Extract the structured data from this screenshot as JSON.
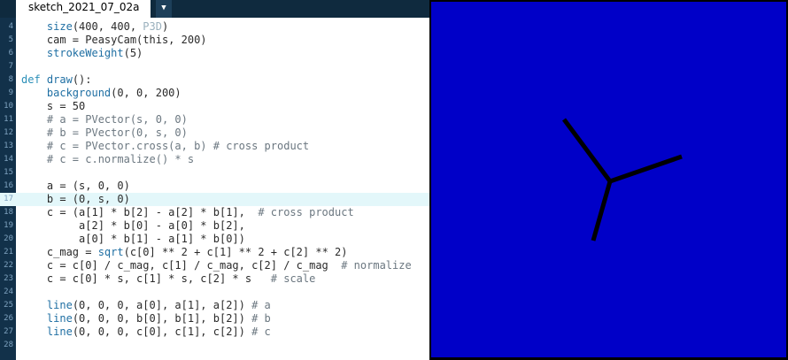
{
  "tab": {
    "title": "sketch_2021_07_02a",
    "menu_arrow": "▼"
  },
  "editor": {
    "highlighted_line": "17",
    "lines": [
      {
        "n": "4",
        "segs": [
          {
            "t": "    "
          },
          {
            "t": "size",
            "c": "fn"
          },
          {
            "t": "(400, 400, "
          },
          {
            "t": "P3D",
            "c": "str"
          },
          {
            "t": ")"
          }
        ]
      },
      {
        "n": "5",
        "segs": [
          {
            "t": "    cam = PeasyCam(this, 200)"
          }
        ]
      },
      {
        "n": "6",
        "segs": [
          {
            "t": "    "
          },
          {
            "t": "strokeWeight",
            "c": "fn"
          },
          {
            "t": "(5)"
          }
        ]
      },
      {
        "n": "7",
        "segs": [
          {
            "t": ""
          }
        ]
      },
      {
        "n": "8",
        "segs": [
          {
            "t": "def ",
            "c": "kw"
          },
          {
            "t": "draw",
            "c": "fn"
          },
          {
            "t": "():"
          }
        ]
      },
      {
        "n": "9",
        "segs": [
          {
            "t": "    "
          },
          {
            "t": "background",
            "c": "fn"
          },
          {
            "t": "(0, 0, 200)"
          }
        ]
      },
      {
        "n": "10",
        "segs": [
          {
            "t": "    s = 50"
          }
        ]
      },
      {
        "n": "11",
        "segs": [
          {
            "t": "    "
          },
          {
            "t": "# a = PVector(s, 0, 0)",
            "c": "cm"
          }
        ]
      },
      {
        "n": "12",
        "segs": [
          {
            "t": "    "
          },
          {
            "t": "# b = PVector(0, s, 0)",
            "c": "cm"
          }
        ]
      },
      {
        "n": "13",
        "segs": [
          {
            "t": "    "
          },
          {
            "t": "# c = PVector.cross(a, b) # cross product",
            "c": "cm"
          }
        ]
      },
      {
        "n": "14",
        "segs": [
          {
            "t": "    "
          },
          {
            "t": "# c = c.normalize() * s",
            "c": "cm"
          }
        ]
      },
      {
        "n": "15",
        "segs": [
          {
            "t": ""
          }
        ]
      },
      {
        "n": "16",
        "segs": [
          {
            "t": "    a = (s, 0, 0)"
          }
        ]
      },
      {
        "n": "17",
        "segs": [
          {
            "t": "    b = (0, s, 0)"
          }
        ]
      },
      {
        "n": "18",
        "segs": [
          {
            "t": "    c = (a[1] * b[2] - a[2] * b[1],  "
          },
          {
            "t": "# cross product",
            "c": "cm"
          }
        ]
      },
      {
        "n": "19",
        "segs": [
          {
            "t": "         a[2] * b[0] - a[0] * b[2],"
          }
        ]
      },
      {
        "n": "20",
        "segs": [
          {
            "t": "         a[0] * b[1] - a[1] * b[0])"
          }
        ]
      },
      {
        "n": "21",
        "segs": [
          {
            "t": "    c_mag = "
          },
          {
            "t": "sqrt",
            "c": "fn"
          },
          {
            "t": "(c[0] ** 2 + c[1] ** 2 + c[2] ** 2)"
          }
        ]
      },
      {
        "n": "22",
        "segs": [
          {
            "t": "    c = c[0] / c_mag, c[1] / c_mag, c[2] / c_mag  "
          },
          {
            "t": "# normalize",
            "c": "cm"
          }
        ]
      },
      {
        "n": "23",
        "segs": [
          {
            "t": "    c = c[0] * s, c[1] * s, c[2] * s   "
          },
          {
            "t": "# scale",
            "c": "cm"
          }
        ]
      },
      {
        "n": "24",
        "segs": [
          {
            "t": ""
          }
        ]
      },
      {
        "n": "25",
        "segs": [
          {
            "t": "    "
          },
          {
            "t": "line",
            "c": "fn"
          },
          {
            "t": "(0, 0, 0, a[0], a[1], a[2]) "
          },
          {
            "t": "# a",
            "c": "cm"
          }
        ]
      },
      {
        "n": "26",
        "segs": [
          {
            "t": "    "
          },
          {
            "t": "line",
            "c": "fn"
          },
          {
            "t": "(0, 0, 0, b[0], b[1], b[2]) "
          },
          {
            "t": "# b",
            "c": "cm"
          }
        ]
      },
      {
        "n": "27",
        "segs": [
          {
            "t": "    "
          },
          {
            "t": "line",
            "c": "fn"
          },
          {
            "t": "(0, 0, 0, c[0], c[1], c[2]) "
          },
          {
            "t": "# c",
            "c": "cm"
          }
        ]
      },
      {
        "n": "28",
        "segs": [
          {
            "t": ""
          }
        ]
      }
    ]
  },
  "sketch_window": {
    "background": "#0000c8",
    "stroke": "#000000"
  }
}
